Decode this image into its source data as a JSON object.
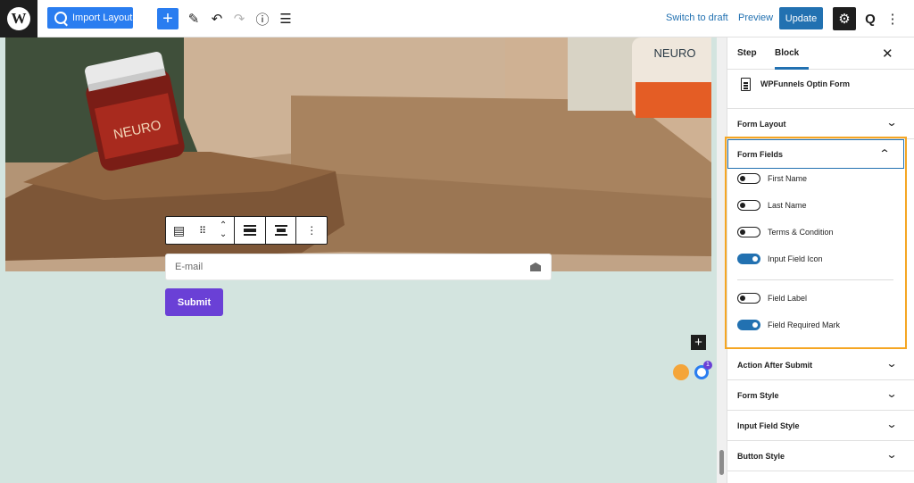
{
  "topbar": {
    "import_label": "Import Layout",
    "switch_draft": "Switch to draft",
    "preview": "Preview",
    "update": "Update"
  },
  "hero": {
    "jar_label": "NEURO",
    "jar_label_2": "NEURO"
  },
  "form": {
    "email_placeholder": "E-mail",
    "submit_label": "Submit",
    "float_badge": "1"
  },
  "sidebar": {
    "tabs": [
      {
        "label": "Step"
      },
      {
        "label": "Block"
      }
    ],
    "active_tab": "Block",
    "block_title": "WPFunnels Optin Form",
    "panels": {
      "form_layout": "Form Layout",
      "form_fields": "Form Fields",
      "action_after_submit": "Action After Submit",
      "form_style": "Form Style",
      "input_field_style": "Input Field Style",
      "button_style": "Button Style"
    },
    "toggles": [
      {
        "label": "First Name",
        "on": false
      },
      {
        "label": "Last Name",
        "on": false
      },
      {
        "label": "Terms & Condition",
        "on": false
      },
      {
        "label": "Input Field Icon",
        "on": true
      },
      {
        "label": "Field Label",
        "on": false
      },
      {
        "label": "Field Required Mark",
        "on": true
      }
    ]
  },
  "colors": {
    "accent": "#2271b1",
    "highlight": "#f5a623",
    "submit": "#6a40d6",
    "canvas_bg": "#d3e4df"
  }
}
